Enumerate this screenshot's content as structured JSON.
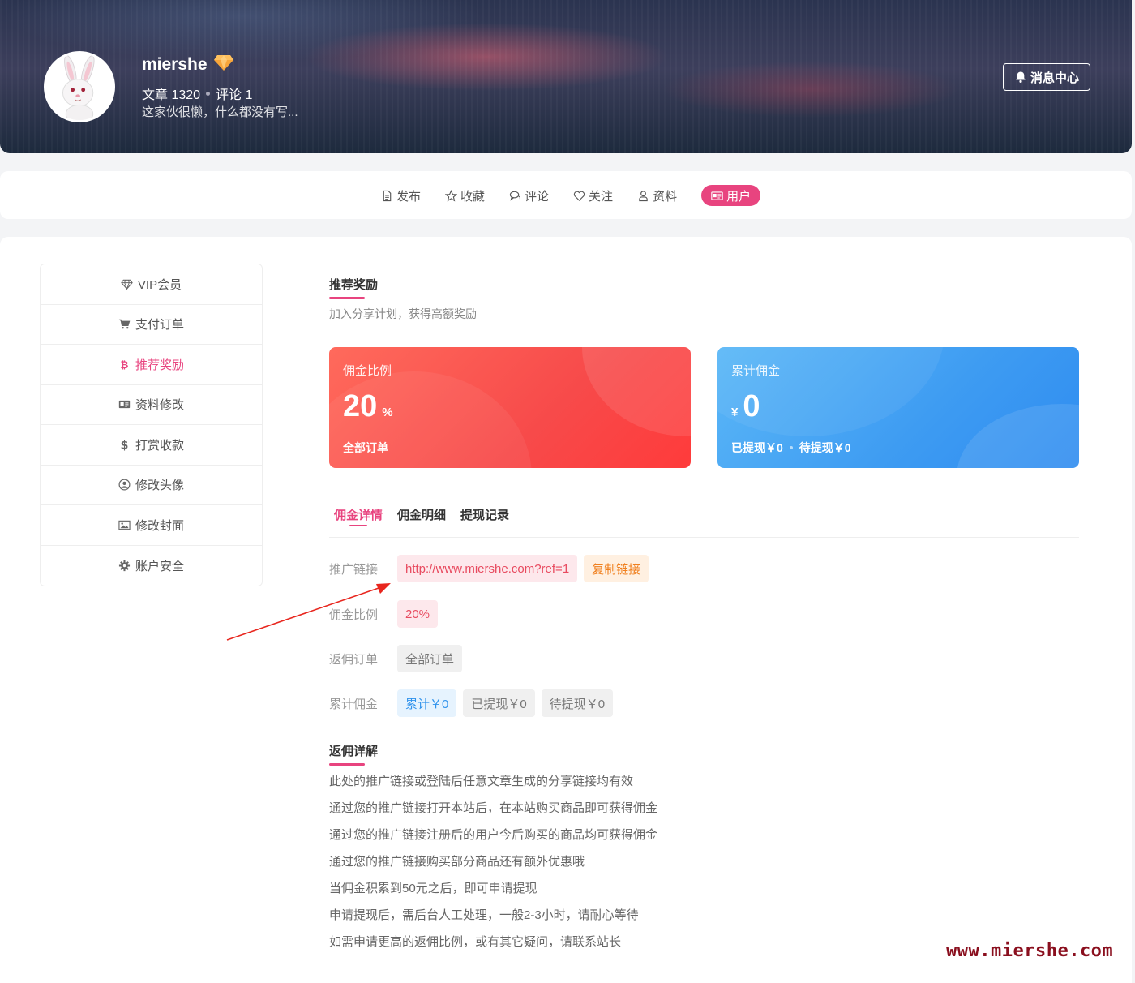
{
  "header": {
    "username": "miershe",
    "articles_label": "文章 1320",
    "comments_label": "评论 1",
    "bio": "这家伙很懒，什么都没有写...",
    "message_center": "消息中心"
  },
  "nav": {
    "items": [
      {
        "label": "发布",
        "icon": "document-icon"
      },
      {
        "label": "收藏",
        "icon": "star-icon"
      },
      {
        "label": "评论",
        "icon": "comment-icon"
      },
      {
        "label": "关注",
        "icon": "heart-icon"
      },
      {
        "label": "资料",
        "icon": "user-icon"
      },
      {
        "label": "用户",
        "icon": "id-card-icon",
        "active": true
      }
    ]
  },
  "sidebar": {
    "items": [
      {
        "label": "VIP会员",
        "icon": "diamond-icon"
      },
      {
        "label": "支付订单",
        "icon": "cart-icon"
      },
      {
        "label": "推荐奖励",
        "icon": "bitcoin-icon",
        "active": true
      },
      {
        "label": "资料修改",
        "icon": "id-card-icon"
      },
      {
        "label": "打赏收款",
        "icon": "dollar-icon"
      },
      {
        "label": "修改头像",
        "icon": "user-circle-icon"
      },
      {
        "label": "修改封面",
        "icon": "image-icon"
      },
      {
        "label": "账户安全",
        "icon": "gear-icon"
      }
    ]
  },
  "reward": {
    "title": "推荐奖励",
    "subtitle": "加入分享计划，获得高额奖励"
  },
  "cards": {
    "rate": {
      "label": "佣金比例",
      "value": "20",
      "unit": "%",
      "foot": "全部订单"
    },
    "total": {
      "label": "累计佣金",
      "currency": "¥",
      "value": "0",
      "withdrawn": "已提现￥0",
      "pending": "待提现￥0"
    }
  },
  "tabs": [
    "佣金详情",
    "佣金明细",
    "提现记录"
  ],
  "details": {
    "link_label": "推广链接",
    "link_value": "http://www.miershe.com?ref=1",
    "copy_button": "复制链接",
    "rate_label": "佣金比例",
    "rate_value": "20%",
    "orders_label": "返佣订单",
    "orders_value": "全部订单",
    "total_label": "累计佣金",
    "total_value": "累计￥0",
    "withdrawn_value": "已提现￥0",
    "pending_value": "待提现￥0"
  },
  "rebate": {
    "title": "返佣详解",
    "lines": [
      "此处的推广链接或登陆后任意文章生成的分享链接均有效",
      "通过您的推广链接打开本站后，在本站购买商品即可获得佣金",
      "通过您的推广链接注册后的用户今后购买的商品均可获得佣金",
      "通过您的推广链接购买部分商品还有额外优惠哦",
      "当佣金积累到50元之后，即可申请提现",
      "申请提现后，需后台人工处理，一般2-3小时，请耐心等待",
      "如需申请更高的返佣比例，或有其它疑问，请联系站长"
    ]
  },
  "watermark": "www.miershe.com",
  "colors": {
    "accent": "#e8447f",
    "card_red": "#f74a4a",
    "card_blue": "#3d9bf2"
  }
}
